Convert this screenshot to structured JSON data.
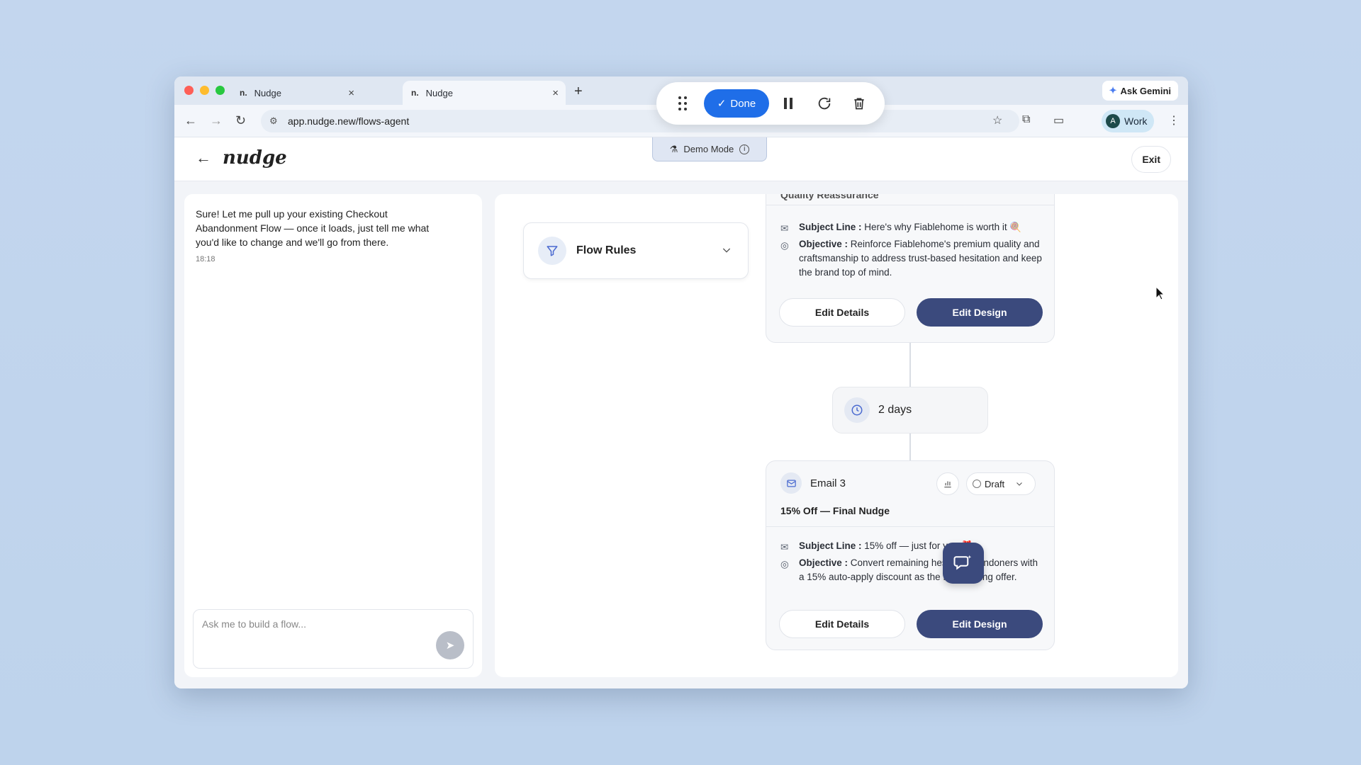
{
  "browser": {
    "tabs": [
      {
        "favicon": "n.",
        "title": "Nudge"
      },
      {
        "favicon": "n.",
        "title": "Nudge"
      }
    ],
    "url": "app.nudge.new/flows-agent",
    "ask_gemini": "Ask Gemini",
    "profile_initial": "A",
    "profile_label": "Work"
  },
  "recorder": {
    "done_label": "Done"
  },
  "app": {
    "logo": "nudge",
    "demo_mode": "Demo Mode",
    "exit_label": "Exit"
  },
  "chat": {
    "message": "Sure! Let me pull up your existing Checkout Abandonment Flow — once it loads, just tell me what you'd like to change and we'll go from there.",
    "time": "18:18",
    "placeholder": "Ask me to build a flow..."
  },
  "flow_rules": {
    "title": "Flow Rules"
  },
  "email2": {
    "title_partial": "Quality Reassurance",
    "subject_label": "Subject Line :",
    "subject": "Here's why Fiablehome is worth it 🍭",
    "objective_label": "Objective :",
    "objective": "Reinforce Fiablehome's premium quality and craftsmanship to address trust-based hesitation and keep the brand top of mind.",
    "edit_details": "Edit Details",
    "edit_design": "Edit Design"
  },
  "delay": {
    "label": "2 days"
  },
  "email3": {
    "name": "Email 3",
    "status": "Draft",
    "title": "15% Off — Final Nudge",
    "subject_label": "Subject Line :",
    "subject": "15% off — just for you 🎁",
    "objective_label": "Objective :",
    "objective": "Convert remaining hesitant abandoners with a 15% auto-apply discount as the final closing offer.",
    "edit_details": "Edit Details",
    "edit_design": "Edit Design"
  },
  "colors": {
    "primary": "#3b4a7d",
    "done_blue": "#1f6ee8",
    "background": "#c3d6ee"
  }
}
